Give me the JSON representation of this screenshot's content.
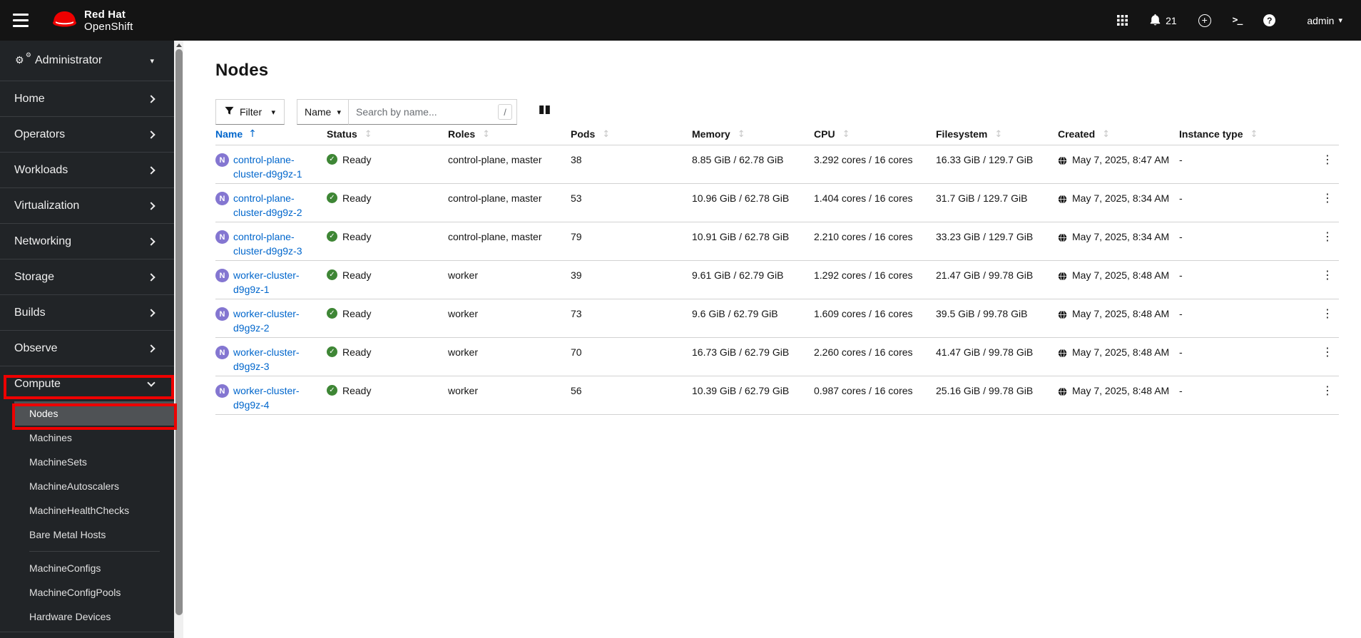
{
  "masthead": {
    "brand_line1": "Red Hat",
    "brand_line2": "OpenShift",
    "notification_count": "21",
    "user_label": "admin"
  },
  "icons": {
    "caret_down": "▾",
    "terminal_glyph": ">_",
    "help_glyph": "?",
    "plus_glyph": "+",
    "cog": "⚙",
    "check": "✓",
    "sort_asc": "↑",
    "sort_both": "↕",
    "kebab": "⋮"
  },
  "sidebar": {
    "perspective_label": "Administrator",
    "nav_items": [
      "Home",
      "Operators",
      "Workloads",
      "Virtualization",
      "Networking",
      "Storage",
      "Builds",
      "Observe"
    ],
    "compute_label": "Compute",
    "compute_group1": [
      "Nodes",
      "Machines",
      "MachineSets",
      "MachineAutoscalers",
      "MachineHealthChecks",
      "Bare Metal Hosts"
    ],
    "compute_group2": [
      "MachineConfigs",
      "MachineConfigPools",
      "Hardware Devices"
    ],
    "selected_item": "Nodes"
  },
  "page": {
    "title": "Nodes"
  },
  "toolbar": {
    "filter_label": "Filter",
    "attribute_label": "Name",
    "search_placeholder": "Search by name...",
    "search_shortcut": "/"
  },
  "table": {
    "node_badge": "N",
    "columns": [
      "Name",
      "Status",
      "Roles",
      "Pods",
      "Memory",
      "CPU",
      "Filesystem",
      "Created",
      "Instance type"
    ],
    "sorted_column": "Name",
    "sort_direction": "ascending",
    "rows": [
      {
        "name": "control-plane-cluster-d9g9z-1",
        "status": "Ready",
        "roles": "control-plane, master",
        "pods": "38",
        "memory": "8.85 GiB / 62.78 GiB",
        "cpu": "3.292 cores / 16 cores",
        "filesystem": "16.33 GiB / 129.7 GiB",
        "created": "May 7, 2025, 8:47 AM",
        "instance_type": "-"
      },
      {
        "name": "control-plane-cluster-d9g9z-2",
        "status": "Ready",
        "roles": "control-plane, master",
        "pods": "53",
        "memory": "10.96 GiB / 62.78 GiB",
        "cpu": "1.404 cores / 16 cores",
        "filesystem": "31.7 GiB / 129.7 GiB",
        "created": "May 7, 2025, 8:34 AM",
        "instance_type": "-"
      },
      {
        "name": "control-plane-cluster-d9g9z-3",
        "status": "Ready",
        "roles": "control-plane, master",
        "pods": "79",
        "memory": "10.91 GiB / 62.78 GiB",
        "cpu": "2.210 cores / 16 cores",
        "filesystem": "33.23 GiB / 129.7 GiB",
        "created": "May 7, 2025, 8:34 AM",
        "instance_type": "-"
      },
      {
        "name": "worker-cluster-d9g9z-1",
        "status": "Ready",
        "roles": "worker",
        "pods": "39",
        "memory": "9.61 GiB / 62.79 GiB",
        "cpu": "1.292 cores / 16 cores",
        "filesystem": "21.47 GiB / 99.78 GiB",
        "created": "May 7, 2025, 8:48 AM",
        "instance_type": "-"
      },
      {
        "name": "worker-cluster-d9g9z-2",
        "status": "Ready",
        "roles": "worker",
        "pods": "73",
        "memory": "9.6 GiB / 62.79 GiB",
        "cpu": "1.609 cores / 16 cores",
        "filesystem": "39.5 GiB / 99.78 GiB",
        "created": "May 7, 2025, 8:48 AM",
        "instance_type": "-"
      },
      {
        "name": "worker-cluster-d9g9z-3",
        "status": "Ready",
        "roles": "worker",
        "pods": "70",
        "memory": "16.73 GiB / 62.79 GiB",
        "cpu": "2.260 cores / 16 cores",
        "filesystem": "41.47 GiB / 99.78 GiB",
        "created": "May 7, 2025, 8:48 AM",
        "instance_type": "-"
      },
      {
        "name": "worker-cluster-d9g9z-4",
        "status": "Ready",
        "roles": "worker",
        "pods": "56",
        "memory": "10.39 GiB / 62.79 GiB",
        "cpu": "0.987 cores / 16 cores",
        "filesystem": "25.16 GiB / 99.78 GiB",
        "created": "May 7, 2025, 8:48 AM",
        "instance_type": "-"
      }
    ]
  },
  "colors": {
    "masthead_bg": "#141414",
    "sidebar_bg": "#212427",
    "selected_item_bg": "#4f5255",
    "link_blue": "#0066cc",
    "status_ready_green": "#3e8635",
    "node_badge_purple": "#8476d1",
    "annotation_red": "#ee0000",
    "row_border": "#d2d2d2"
  }
}
